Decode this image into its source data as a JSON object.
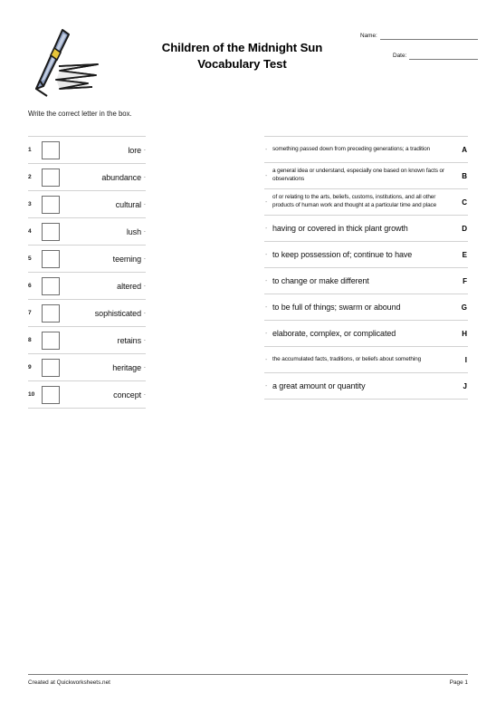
{
  "header": {
    "title_line1": "Children of the Midnight Sun",
    "title_line2": "Vocabulary Test",
    "name_label": "Name:",
    "date_label": "Date:",
    "pen_icon": "fountain-pen-writing-icon"
  },
  "instruction": "Write the correct letter in the box.",
  "words": [
    {
      "num": "1",
      "text": "lore",
      "dash": "-"
    },
    {
      "num": "2",
      "text": "abundance",
      "dash": "-"
    },
    {
      "num": "3",
      "text": "cultural",
      "dash": "-"
    },
    {
      "num": "4",
      "text": "lush",
      "dash": "-"
    },
    {
      "num": "5",
      "text": "teeming",
      "dash": "-"
    },
    {
      "num": "6",
      "text": "altered",
      "dash": "-"
    },
    {
      "num": "7",
      "text": "sophisticated",
      "dash": "-"
    },
    {
      "num": "8",
      "text": "retains",
      "dash": "-"
    },
    {
      "num": "9",
      "text": "heritage",
      "dash": "-"
    },
    {
      "num": "10",
      "text": "concept",
      "dash": "-"
    }
  ],
  "definitions": [
    {
      "letter": "A",
      "text": "something passed down from preceding generations; a tradition",
      "size": "small",
      "dash": "-"
    },
    {
      "letter": "B",
      "text": "a general idea or understand, especially one based on known facts or observations",
      "size": "small",
      "dash": "-"
    },
    {
      "letter": "C",
      "text": "of or relating to the arts, beliefs, customs, institutions, and all other products of human work and thought at a particular time and place",
      "size": "small",
      "dash": "-"
    },
    {
      "letter": "D",
      "text": "having or covered in thick plant growth",
      "size": "normal",
      "dash": "-"
    },
    {
      "letter": "E",
      "text": "to keep possession of; continue to have",
      "size": "normal",
      "dash": "-"
    },
    {
      "letter": "F",
      "text": "to change or make different",
      "size": "normal",
      "dash": "-"
    },
    {
      "letter": "G",
      "text": "to be full of things; swarm or abound",
      "size": "normal",
      "dash": "-"
    },
    {
      "letter": "H",
      "text": "elaborate, complex, or complicated",
      "size": "normal",
      "dash": "-"
    },
    {
      "letter": "I",
      "text": "the accumulated facts, traditions, or beliefs about something",
      "size": "small",
      "dash": "-"
    },
    {
      "letter": "J",
      "text": "a great amount or quantity",
      "size": "normal",
      "dash": "-"
    }
  ],
  "footer": {
    "credit": "Created at Quickworksheets.net",
    "page": "Page 1"
  },
  "colors": {
    "pen_body": "#8a9bbd",
    "pen_highlight": "#c4cfe2",
    "pen_band": "#e8c63a",
    "pen_outline": "#1a1a1a",
    "rule": "#d2d2d2",
    "box_border": "#6e6e6e"
  }
}
